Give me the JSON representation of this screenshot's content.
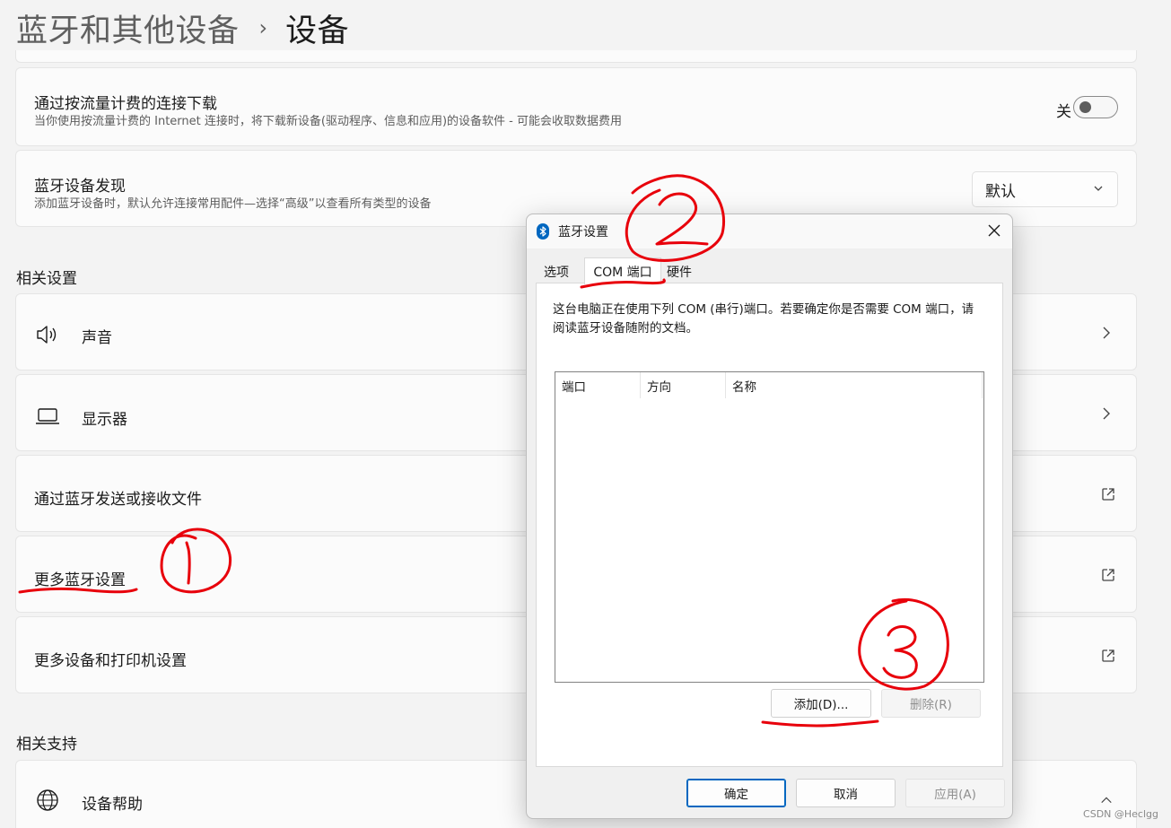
{
  "breadcrumb": {
    "parent": "蓝牙和其他设备",
    "separator": "›",
    "current": "设备"
  },
  "metered": {
    "title": "通过按流量计费的连接下载",
    "desc": "当你使用按流量计费的 Internet 连接时，将下载新设备(驱动程序、信息和应用)的设备软件 - 可能会收取数据费用",
    "toggle_label": "关",
    "toggle_on": false
  },
  "discovery": {
    "title": "蓝牙设备发现",
    "desc": "添加蓝牙设备时，默认允许连接常用配件—选择“高级”以查看所有类型的设备",
    "dropdown_value": "默认"
  },
  "related_settings": {
    "label": "相关设置",
    "items": [
      {
        "label": "声音",
        "icon": "speaker-icon",
        "action": "chevron"
      },
      {
        "label": "显示器",
        "icon": "laptop-icon",
        "action": "chevron"
      },
      {
        "label": "通过蓝牙发送或接收文件",
        "action": "external"
      },
      {
        "label": "更多蓝牙设置",
        "action": "external"
      },
      {
        "label": "更多设备和打印机设置",
        "action": "external"
      }
    ]
  },
  "related_support": {
    "label": "相关支持",
    "items": [
      {
        "label": "设备帮助",
        "icon": "globe-icon",
        "action": "collapse"
      }
    ]
  },
  "dialog": {
    "title": "蓝牙设置",
    "tabs": [
      "选项",
      "COM 端口",
      "硬件"
    ],
    "active_tab": 1,
    "description": "这台电脑正在使用下列 COM (串行)端口。若要确定你是否需要 COM 端口，请阅读蓝牙设备随附的文档。",
    "columns": [
      "端口",
      "方向",
      "名称"
    ],
    "add_button": "添加(D)...",
    "remove_button": "删除(R)",
    "ok_button": "确定",
    "cancel_button": "取消",
    "apply_button": "应用(A)"
  },
  "annotations": [
    "1",
    "2",
    "3"
  ],
  "watermark": "CSDN @Heclgg",
  "colors": {
    "accent": "#0067c0",
    "annotation": "#e8000b",
    "background": "#f3f3f3",
    "card": "#fbfbfb"
  }
}
